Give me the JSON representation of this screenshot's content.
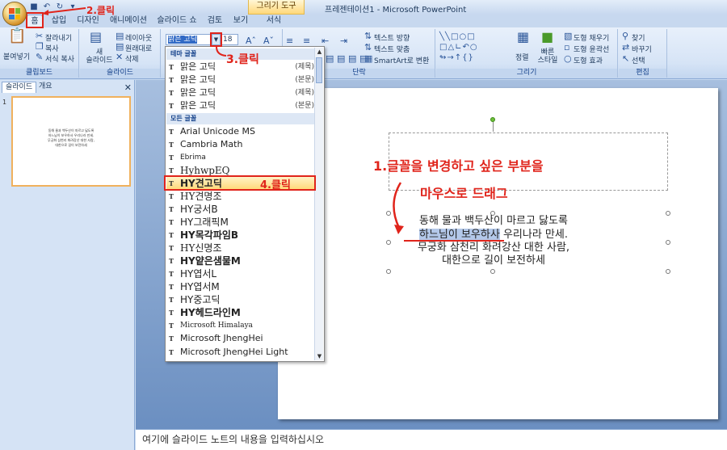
{
  "titlebar": {
    "contextual_tab": "그리기 도구",
    "app_title": "프레젠테이션1 - Microsoft PowerPoint"
  },
  "tabs": [
    {
      "label": "홈"
    },
    {
      "label": "삽입"
    },
    {
      "label": "디자인"
    },
    {
      "label": "애니메이션"
    },
    {
      "label": "슬라이드 쇼"
    },
    {
      "label": "검토"
    },
    {
      "label": "보기"
    },
    {
      "label": "서식"
    }
  ],
  "ribbon": {
    "clipboard": {
      "paste": "붙여넣기",
      "cut": "잘라내기",
      "copy": "복사",
      "format_painter": "서식 복사",
      "label": "클립보드"
    },
    "slides": {
      "new_slide": "새\n슬라이드",
      "layout": "레이아웃",
      "reset": "원래대로",
      "delete": "삭제",
      "label": "슬라이드"
    },
    "font": {
      "current_font": "맑은 고딕",
      "size": "18"
    },
    "paragraph": {
      "text_direction": "텍스트 방향",
      "align_text": "텍스트 맞춤",
      "smartart": "SmartArt로 변환",
      "label": "단락"
    },
    "drawing": {
      "arrange": "정렬",
      "quick_styles": "빠른\n스타일",
      "fill": "도형 채우기",
      "outline": "도형 윤곽선",
      "effects": "도형 효과",
      "label": "그리기"
    },
    "editing": {
      "find": "찾기",
      "replace": "바꾸기",
      "select": "선택",
      "label": "편집"
    }
  },
  "panel": {
    "tab_slides": "슬라이드",
    "tab_outline": "개요",
    "slide_number": "1"
  },
  "font_dropdown": {
    "theme_header": "테마 글꼴",
    "theme_fonts": [
      {
        "name": "맑은 고딕",
        "tag": "(제목)"
      },
      {
        "name": "맑은 고딕",
        "tag": "(본문)"
      },
      {
        "name": "맑은 고딕",
        "tag": "(제목)"
      },
      {
        "name": "맑은 고딕",
        "tag": "(본문)"
      }
    ],
    "all_header": "모든 글꼴",
    "fonts": [
      "Arial Unicode MS",
      "Cambria Math",
      "Ebrima",
      "HyhwpEQ",
      "HY견고딕",
      "HY견명조",
      "HY궁서B",
      "HY그래픽M",
      "HY목각파임B",
      "HY신명조",
      "HY얕은샘물M",
      "HY엽서L",
      "HY엽서M",
      "HY중고딕",
      "HY헤드라인M",
      "Microsoft Himalaya",
      "Microsoft JhengHei",
      "Microsoft JhengHei Light"
    ],
    "selected_font": "HY견고딕"
  },
  "slide": {
    "line1": "동해 물과 백두산이 마르고 닳도록",
    "line2_highlight": "하느님이 보우하사",
    "line2_rest": " 우리나라 만세.",
    "line3": "무궁화 삼천리 화려강산 대한 사람,",
    "line4": "대한으로 길이 보전하세"
  },
  "notes": {
    "placeholder": "여기에 슬라이드 노트의 내용을 입력하십시오"
  },
  "annotations": {
    "step1_line1": "1.글꼴을 변경하고 싶은 부분을",
    "step1_line2": "마우스로 드래그",
    "step2": "2.클릭",
    "step3": "3.클릭",
    "step4": "4.클릭"
  },
  "colors": {
    "accent_red": "#e0241b",
    "ribbon_blue": "#c7d8ef",
    "selection_gold": "#ffd776"
  }
}
